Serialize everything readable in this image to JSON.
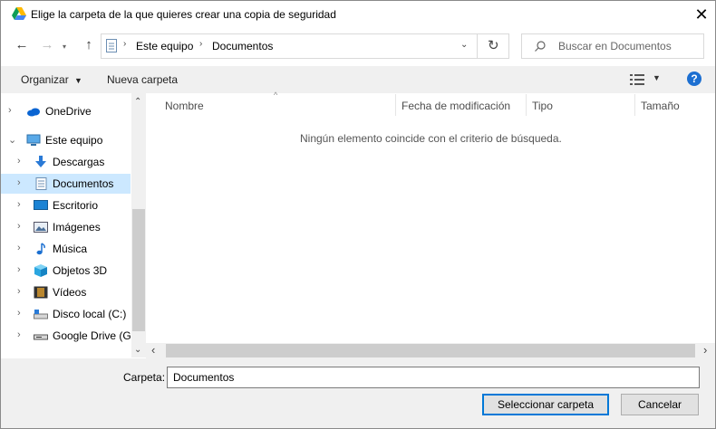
{
  "window": {
    "title": "Elige la carpeta de la que quieres crear una copia de seguridad",
    "close_glyph": "✕"
  },
  "nav": {
    "back_glyph": "←",
    "forward_glyph": "→",
    "up_glyph": "↑",
    "refresh_glyph": "↻",
    "breadcrumb": [
      "Este equipo",
      "Documentos"
    ],
    "search_placeholder": "Buscar en Documentos"
  },
  "toolbar": {
    "organize_label": "Organizar",
    "new_folder_label": "Nueva carpeta",
    "help_glyph": "?"
  },
  "sidebar": {
    "items": [
      {
        "label": "OneDrive",
        "icon": "cloud-icon"
      },
      {
        "label": "Este equipo",
        "icon": "computer-icon"
      },
      {
        "label": "Descargas",
        "icon": "download-icon"
      },
      {
        "label": "Documentos",
        "icon": "document-icon"
      },
      {
        "label": "Escritorio",
        "icon": "desktop-icon"
      },
      {
        "label": "Imágenes",
        "icon": "pictures-icon"
      },
      {
        "label": "Música",
        "icon": "music-icon"
      },
      {
        "label": "Objetos 3D",
        "icon": "3d-objects-icon"
      },
      {
        "label": "Vídeos",
        "icon": "videos-icon"
      },
      {
        "label": "Disco local (C:)",
        "icon": "drive-icon"
      },
      {
        "label": "Google Drive (G:",
        "icon": "drive-icon"
      }
    ]
  },
  "columns": {
    "name": "Nombre",
    "modified": "Fecha de modificación",
    "type": "Tipo",
    "size": "Tamaño"
  },
  "content": {
    "empty_message": "Ningún elemento coincide con el criterio de búsqueda."
  },
  "footer": {
    "folder_label": "Carpeta:",
    "folder_value": "Documentos",
    "select_label": "Seleccionar carpeta",
    "cancel_label": "Cancelar"
  },
  "colors": {
    "selected_bg": "#cce8ff",
    "accent": "#0078d7"
  }
}
